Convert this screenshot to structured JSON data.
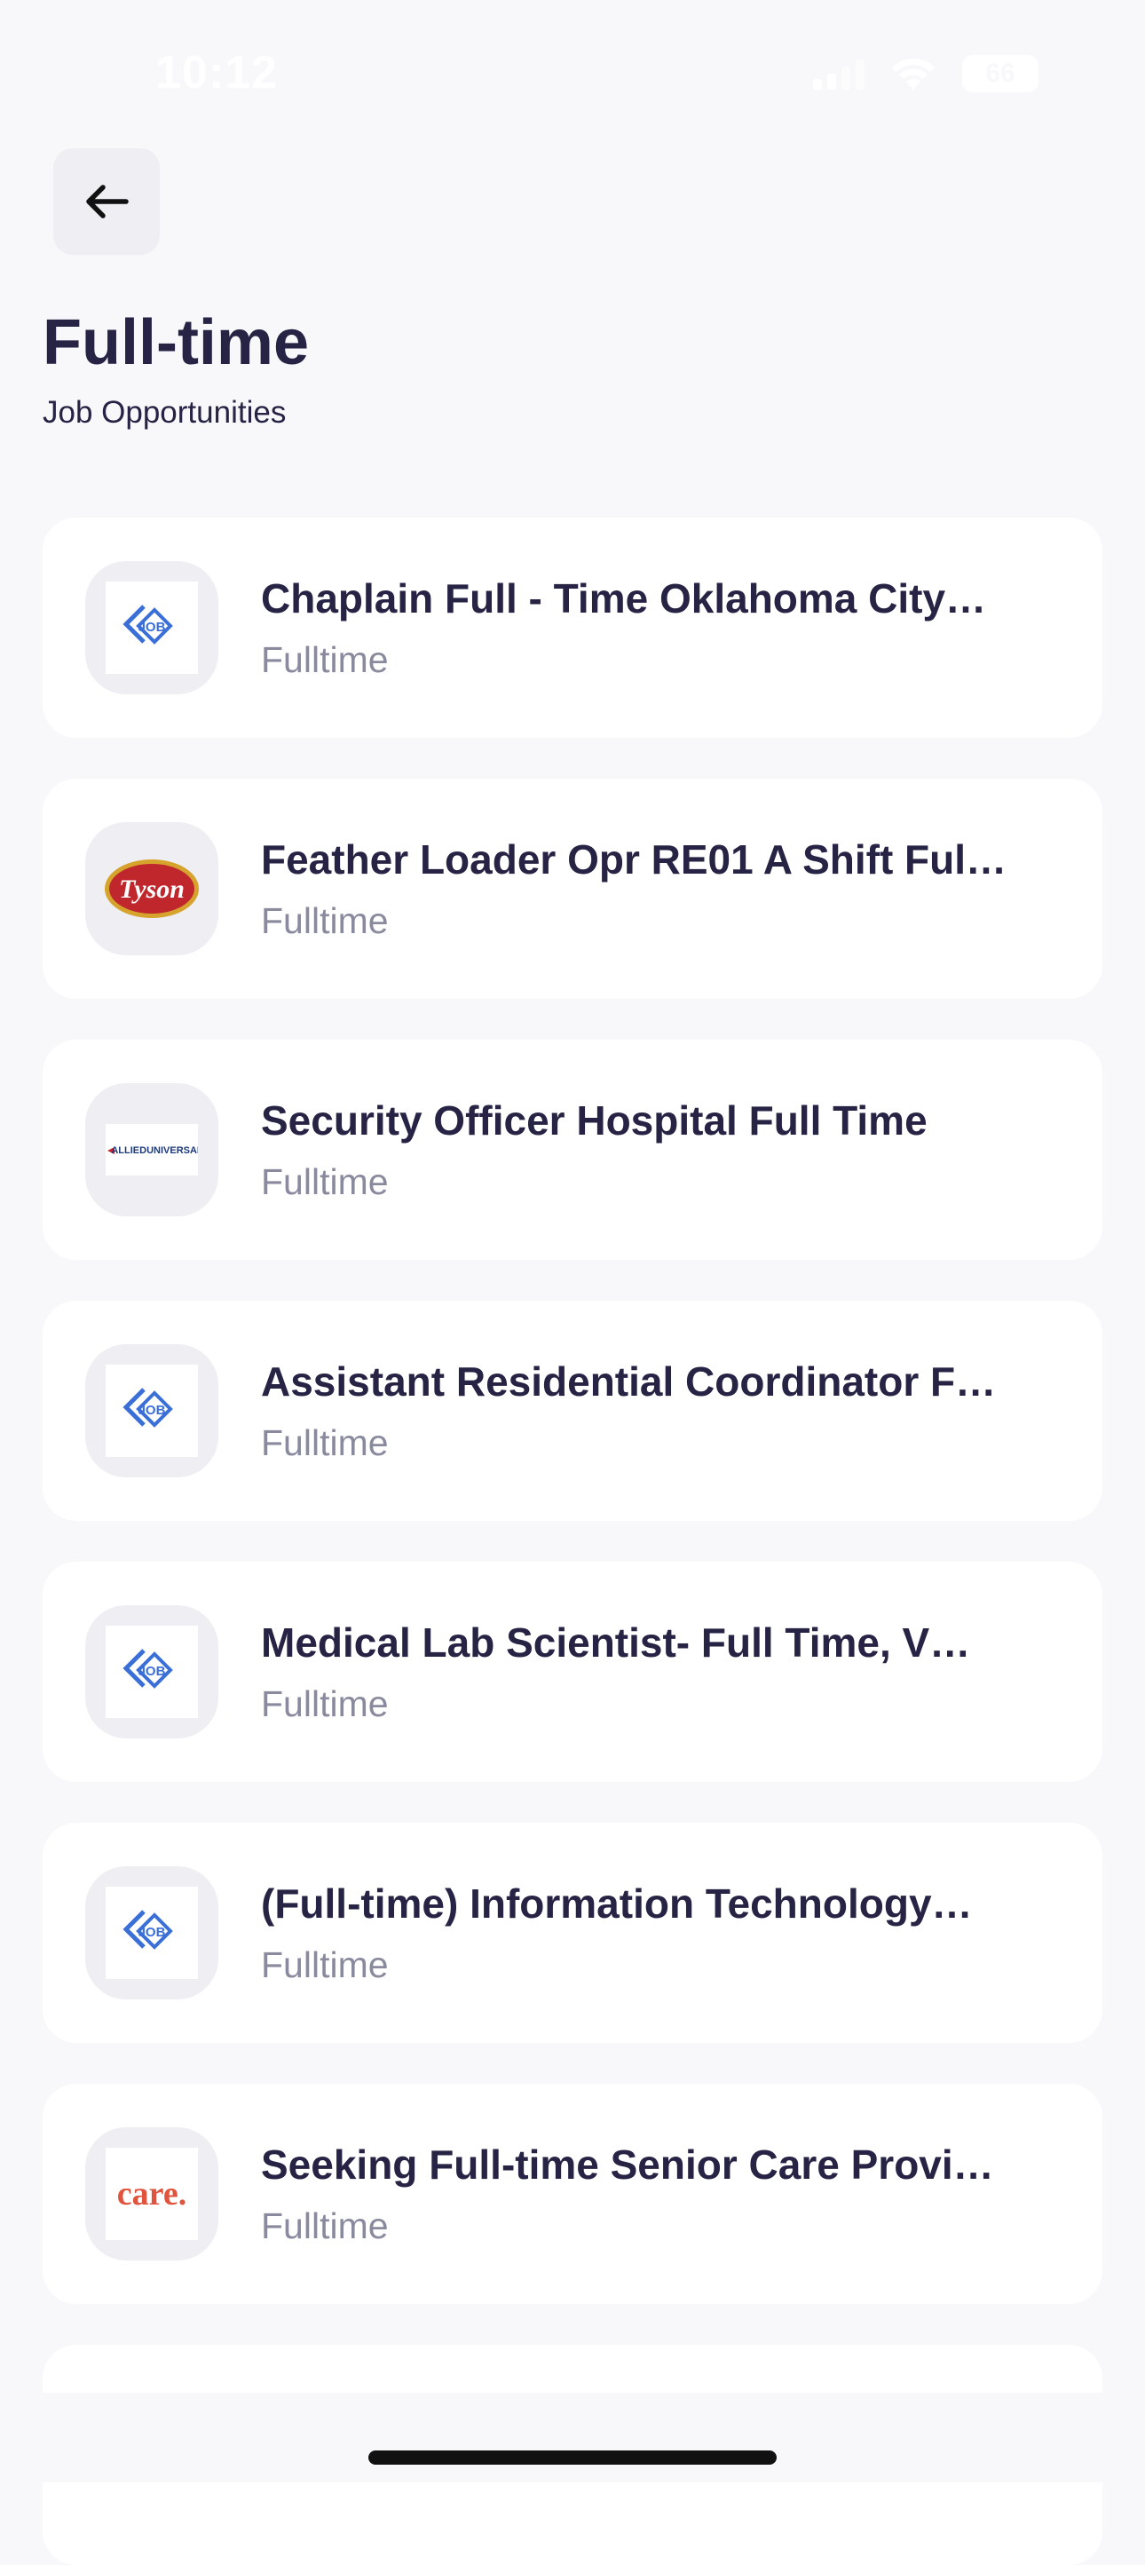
{
  "status_bar": {
    "time": "10:12",
    "battery": "66"
  },
  "header": {
    "title": "Full-time",
    "subtitle": "Job Opportunities"
  },
  "jobs": [
    {
      "title": "Chaplain Full - Time Oklahoma City…",
      "type": "Fulltime",
      "logo": "job-logo"
    },
    {
      "title": "Feather Loader Opr RE01 A Shift Ful…",
      "type": "Fulltime",
      "logo": "tyson-logo",
      "logo_text": "Tyson"
    },
    {
      "title": "Security Officer Hospital Full Time",
      "type": "Fulltime",
      "logo": "allied-universal-logo",
      "logo_text": "ALLIEDUNIVERSAL"
    },
    {
      "title": "Assistant Residential Coordinator F…",
      "type": "Fulltime",
      "logo": "job-logo"
    },
    {
      "title": "Medical Lab Scientist- Full Time, V…",
      "type": "Fulltime",
      "logo": "job-logo"
    },
    {
      "title": "(Full-time) Information Technology…",
      "type": "Fulltime",
      "logo": "job-logo"
    },
    {
      "title": "Seeking Full-time Senior Care Provi…",
      "type": "Fulltime",
      "logo": "care-logo",
      "logo_text": "care."
    }
  ],
  "colors": {
    "background": "#f8f8fb",
    "title": "#262344",
    "muted": "#8a8a9e",
    "job_logo_blue": "#3b6fd8",
    "tyson_red": "#c0272d",
    "care_red": "#e0533d"
  }
}
